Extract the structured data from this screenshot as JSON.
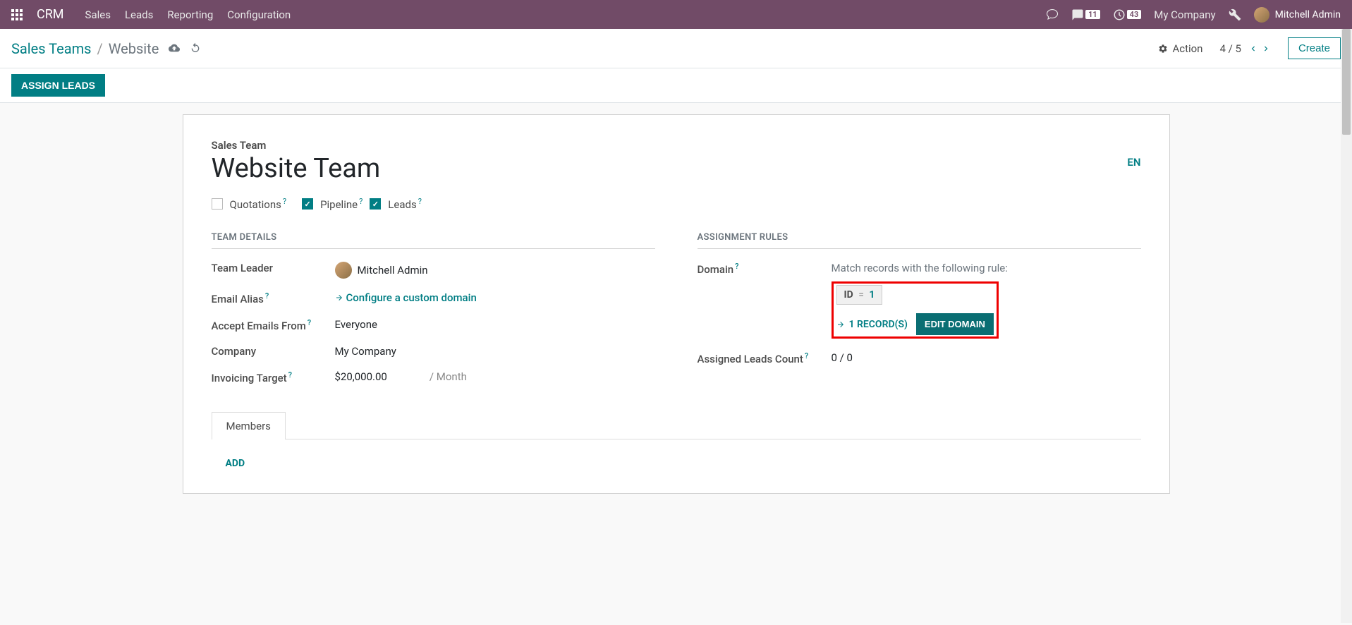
{
  "topnav": {
    "brand": "CRM",
    "items": [
      "Sales",
      "Leads",
      "Reporting",
      "Configuration"
    ],
    "conversation_badge": "11",
    "activity_badge": "43",
    "company": "My Company",
    "user": "Mitchell Admin"
  },
  "breadcrumb": {
    "root": "Sales Teams",
    "current": "Website",
    "action_label": "Action",
    "pager": "4 / 5",
    "create_label": "Create"
  },
  "status_bar": {
    "assign_leads": "ASSIGN LEADS"
  },
  "form": {
    "label": "Sales Team",
    "name": "Website Team",
    "lang": "EN",
    "checkboxes": {
      "quotations": {
        "label": "Quotations",
        "checked": false
      },
      "pipeline": {
        "label": "Pipeline",
        "checked": true
      },
      "leads": {
        "label": "Leads",
        "checked": true
      }
    }
  },
  "team_details": {
    "title": "TEAM DETAILS",
    "rows": {
      "team_leader": {
        "label": "Team Leader",
        "value": "Mitchell Admin"
      },
      "email_alias": {
        "label": "Email Alias",
        "link": "Configure a custom domain"
      },
      "accept_emails": {
        "label": "Accept Emails From",
        "value": "Everyone"
      },
      "company": {
        "label": "Company",
        "value": "My Company"
      },
      "invoicing_target": {
        "label": "Invoicing Target",
        "value": "$20,000.00",
        "suffix": "/ Month"
      }
    }
  },
  "assignment_rules": {
    "title": "ASSIGNMENT RULES",
    "domain_label": "Domain",
    "domain_rule_text": "Match records with the following rule:",
    "domain_rule": {
      "field": "ID",
      "op": "=",
      "value": "1"
    },
    "records_link": "1 RECORD(S)",
    "edit_domain_btn": "EDIT DOMAIN",
    "assigned_leads_label": "Assigned Leads Count",
    "assigned_leads_value": "0 / 0"
  },
  "tabs": {
    "members": "Members",
    "add": "ADD"
  }
}
